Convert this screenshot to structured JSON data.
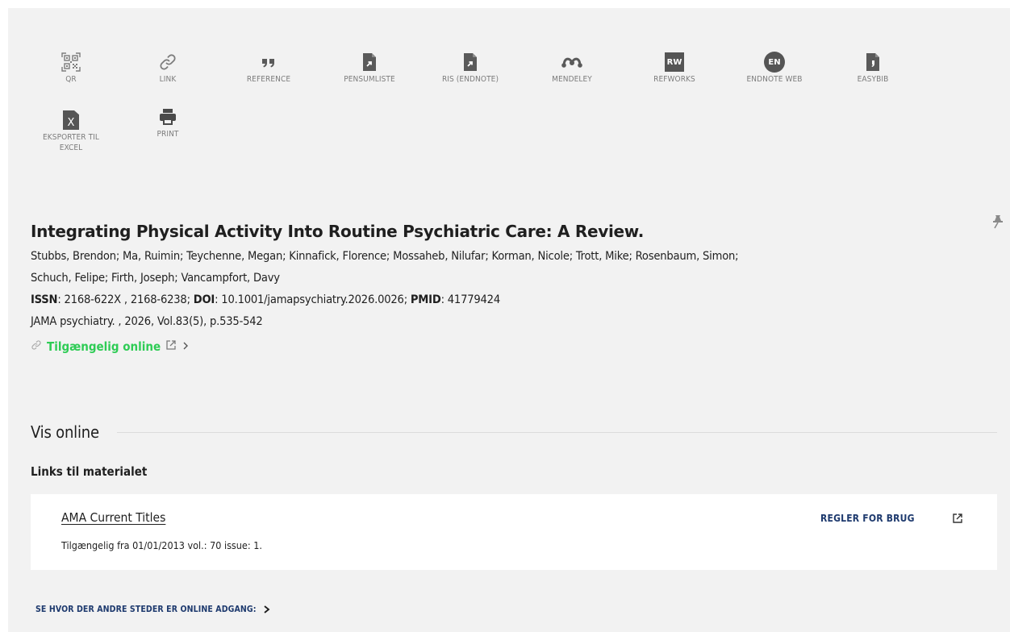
{
  "actions": [
    {
      "label": "QR",
      "icon": "qr-code-icon"
    },
    {
      "label": "LINK",
      "icon": "link-icon"
    },
    {
      "label": "REFERENCE",
      "icon": "quote-icon"
    },
    {
      "label": "PENSUMLISTE",
      "icon": "file-export-icon"
    },
    {
      "label": "RIS (ENDNOTE)",
      "icon": "file-export-icon"
    },
    {
      "label": "MENDELEY",
      "icon": "mendeley-icon"
    },
    {
      "label": "REFWORKS",
      "icon": "refworks-icon"
    },
    {
      "label": "ENDNOTE WEB",
      "icon": "endnote-web-icon"
    },
    {
      "label": "EASYBIB",
      "icon": "easybib-icon"
    },
    {
      "label": "EKSPORTER TIL EXCEL",
      "icon": "excel-icon"
    },
    {
      "label": "PRINT",
      "icon": "print-icon"
    }
  ],
  "icon_text": {
    "refworks": "RW",
    "endnote": "EN",
    "excel": "X"
  },
  "record": {
    "title": "Integrating Physical Activity Into Routine Psychiatric Care: A Review.",
    "authors_line1": "Stubbs, Brendon; Ma, Ruimin; Teychenne, Megan; Kinnafick, Florence; Mossaheb, Nilufar; Korman, Nicole; Trott, Mike; Rosenbaum, Simon;",
    "authors_line2": "Schuch, Felipe; Firth, Joseph; Vancampfort, Davy",
    "issn_label": "ISSN",
    "issn_value": ": 2168-622X , 2168-6238; ",
    "doi_label": "DOI",
    "doi_value": ": 10.1001/jamapsychiatry.2026.0026; ",
    "pmid_label": "PMID",
    "pmid_value": ": 41779424",
    "source": "JAMA psychiatry. , 2026, Vol.83(5), p.535-542",
    "availability": "Tilgængelig online"
  },
  "vis_online": {
    "heading": "Vis online",
    "links_heading": "Links til materialet",
    "link": {
      "source_name": "AMA Current Titles",
      "coverage": "Tilgængelig fra 01/01/2013 vol.: 70 issue: 1.",
      "rules_label": "REGLER FOR BRUG"
    },
    "see_where_label": "SE HVOR DER ANDRE STEDER ER ONLINE ADGANG:"
  },
  "colors": {
    "panel_bg": "#f2f2f2",
    "icon_gray": "#7c7c7c",
    "available_green": "#2ecc55",
    "link_navy": "#1e3a6e"
  }
}
